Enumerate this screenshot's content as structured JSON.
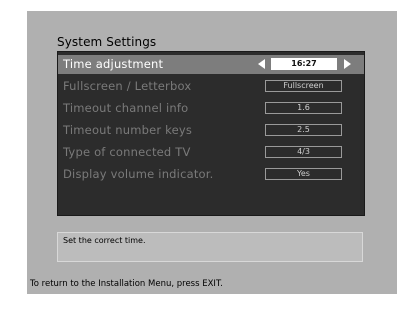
{
  "title": "System Settings",
  "rows": [
    {
      "label": "Time adjustment",
      "value": "16:27"
    },
    {
      "label": "Fullscreen / Letterbox",
      "value": "Fullscreen"
    },
    {
      "label": "Timeout channel info",
      "value": "1.6"
    },
    {
      "label": "Timeout number keys",
      "value": "2.5"
    },
    {
      "label": "Type of connected TV",
      "value": "4/3"
    },
    {
      "label": "Display volume indicator.",
      "value": "Yes"
    }
  ],
  "help_text": "Set the correct time.",
  "footer": "To return to the Installation Menu, press EXIT.",
  "colors": {
    "background": "#a8a8a8",
    "panel": "#2c2c2c",
    "selected_row": "#7d7d7d",
    "inactive_text": "#7a7a7a"
  },
  "icons": {
    "left": "left-arrow-icon",
    "right": "right-arrow-icon"
  }
}
